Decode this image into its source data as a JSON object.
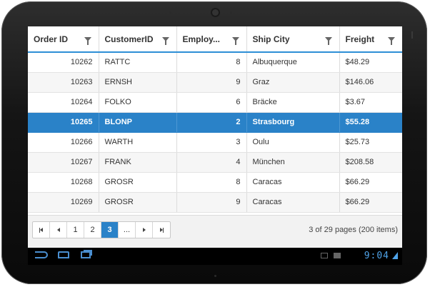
{
  "grid": {
    "columns": [
      {
        "label": "Order ID",
        "align": "right"
      },
      {
        "label": "CustomerID",
        "align": "left"
      },
      {
        "label": "Employ...",
        "align": "right"
      },
      {
        "label": "Ship City",
        "align": "left"
      },
      {
        "label": "Freight",
        "align": "left"
      }
    ],
    "rows": [
      {
        "order_id": "10262",
        "customer_id": "RATTC",
        "employee": "8",
        "ship_city": "Albuquerque",
        "freight": "$48.29"
      },
      {
        "order_id": "10263",
        "customer_id": "ERNSH",
        "employee": "9",
        "ship_city": "Graz",
        "freight": "$146.06"
      },
      {
        "order_id": "10264",
        "customer_id": "FOLKO",
        "employee": "6",
        "ship_city": "Bräcke",
        "freight": "$3.67"
      },
      {
        "order_id": "10265",
        "customer_id": "BLONP",
        "employee": "2",
        "ship_city": "Strasbourg",
        "freight": "$55.28"
      },
      {
        "order_id": "10266",
        "customer_id": "WARTH",
        "employee": "3",
        "ship_city": "Oulu",
        "freight": "$25.73"
      },
      {
        "order_id": "10267",
        "customer_id": "FRANK",
        "employee": "4",
        "ship_city": "München",
        "freight": "$208.58"
      },
      {
        "order_id": "10268",
        "customer_id": "GROSR",
        "employee": "8",
        "ship_city": "Caracas",
        "freight": "$66.29"
      },
      {
        "order_id": "10269",
        "customer_id": "GROSR",
        "employee": "9",
        "ship_city": "Caracas",
        "freight": "$66.29"
      }
    ],
    "selected_row_index": 3
  },
  "pager": {
    "pages": [
      "1",
      "2",
      "3",
      "..."
    ],
    "current_page": "3",
    "info": "3 of 29 pages (200 items)"
  },
  "system_bar": {
    "time": "9:04"
  },
  "colors": {
    "accent": "#2a82c8",
    "header_underline": "#2d8fd6",
    "clock": "#4fa3e8"
  }
}
